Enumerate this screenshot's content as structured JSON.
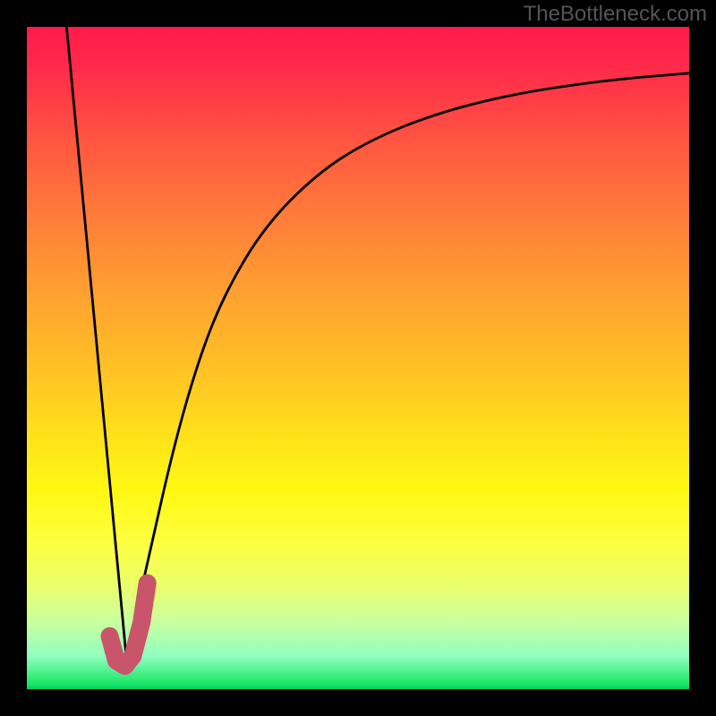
{
  "watermark": "TheBottleneck.com",
  "chart_data": {
    "type": "line",
    "title": "",
    "xlabel": "",
    "ylabel": "",
    "xlim": [
      0,
      100
    ],
    "ylim": [
      0,
      100
    ],
    "grid": false,
    "series": [
      {
        "name": "left-descent",
        "color": "#000000",
        "width": 2.8,
        "x": [
          6,
          15
        ],
        "y": [
          100,
          5
        ]
      },
      {
        "name": "right-ascent",
        "color": "#000000",
        "width": 2.8,
        "x": [
          15,
          18,
          22,
          26,
          30,
          36,
          44,
          52,
          62,
          74,
          88,
          100
        ],
        "y": [
          5,
          18,
          36,
          50,
          60,
          70,
          78,
          83,
          87,
          90,
          92,
          93
        ]
      },
      {
        "name": "j-mark",
        "color": "#c9556b",
        "width": 20,
        "linecap": "round",
        "x": [
          12.5,
          13.5,
          14.8,
          16.0,
          17.3,
          18.2
        ],
        "y": [
          8,
          4.3,
          3.5,
          5,
          10,
          16
        ]
      }
    ],
    "background_gradient": [
      {
        "stop": 0,
        "color": "#ff1a4b"
      },
      {
        "stop": 70,
        "color": "#fff812"
      },
      {
        "stop": 100,
        "color": "#00d060"
      }
    ]
  }
}
